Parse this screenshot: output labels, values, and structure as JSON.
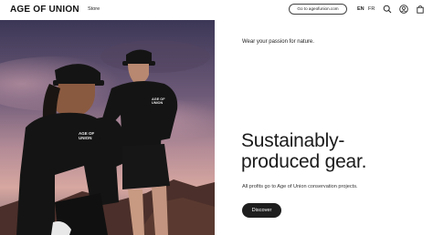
{
  "header": {
    "logo_text": "AGE OF UNION",
    "nav_store": "Store",
    "goto_button": "Go to ageofunion.com",
    "lang_en": "EN",
    "lang_fr": "FR",
    "icons": [
      "search-icon",
      "account-icon",
      "cart-icon"
    ]
  },
  "hero": {
    "image_description_icon": "models-photo",
    "shirt_print": "AGE OF UNION",
    "cap_print": "AGE OF UNION"
  },
  "content": {
    "tagline": "Wear your passion for nature.",
    "headline_line1": "Sustainably-",
    "headline_line2": "produced gear.",
    "subline": "All profits go to Age of Union conservation projects.",
    "cta_label": "Discover"
  },
  "colors": {
    "accent": "#1e1e1e",
    "sky_top": "#3a3553",
    "sky_mid": "#9a7a8f",
    "sky_glow": "#d9a7a0"
  }
}
